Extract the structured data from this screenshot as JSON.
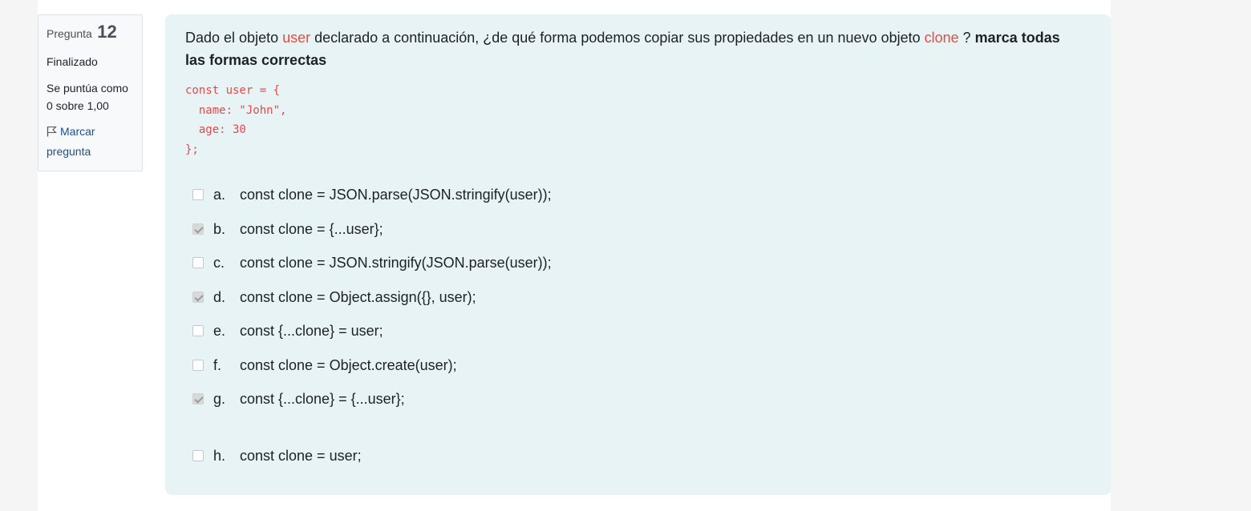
{
  "info": {
    "question_label": "Pregunta",
    "question_number": "12",
    "state": "Finalizado",
    "grade_line1": "Se puntúa como",
    "grade_line2": "0 sobre 1,00",
    "flag_line1": "Marcar",
    "flag_line2": "pregunta"
  },
  "question": {
    "text_1": "Dado el objeto ",
    "highlight_user": "user",
    "text_2": " declarado a continuación, ¿de qué forma podemos copiar sus propiedades en un nuevo objeto ",
    "highlight_clone": "clone",
    "text_3": " ? ",
    "bold": "marca todas las formas correctas",
    "code": "const user = {\n  name: \"John\",\n  age: 30\n};"
  },
  "options": [
    {
      "letter": "a.",
      "text": "const clone = JSON.parse(JSON.stringify(user));",
      "checked": false
    },
    {
      "letter": "b.",
      "text": "const clone = {...user};",
      "checked": true
    },
    {
      "letter": "c.",
      "text": "const clone = JSON.stringify(JSON.parse(user));",
      "checked": false
    },
    {
      "letter": "d.",
      "text": "const clone = Object.assign({}, user);",
      "checked": true
    },
    {
      "letter": "e.",
      "text": "const {...clone} = user;",
      "checked": false
    },
    {
      "letter": "f.",
      "text": "const clone = Object.create(user);",
      "checked": false
    },
    {
      "letter": "g.",
      "text": "const {...clone} = {...user};",
      "checked": true
    },
    {
      "letter": "h.",
      "text": "const clone = user;",
      "checked": false
    }
  ],
  "colors": {
    "highlight": "#e74c3c",
    "panel_bg": "#e7f3f5",
    "link": "#1f4e8c"
  }
}
